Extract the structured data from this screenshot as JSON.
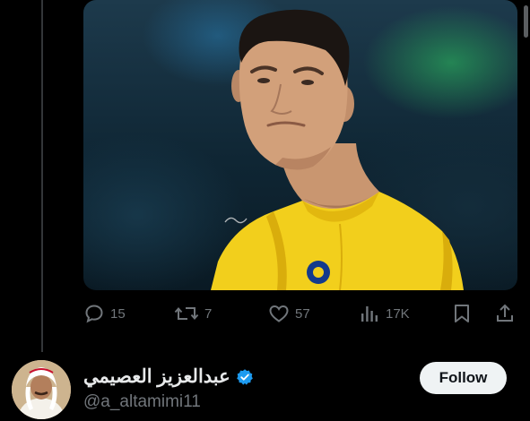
{
  "tweet": {
    "media": {
      "type": "photo",
      "watermark_icon": "signature-watermark-icon"
    },
    "actions": {
      "reply": {
        "icon": "reply-icon",
        "count": "15"
      },
      "retweet": {
        "icon": "retweet-icon",
        "count": "7"
      },
      "like": {
        "icon": "heart-icon",
        "count": "57"
      },
      "views": {
        "icon": "views-icon",
        "count": "17K"
      },
      "bookmark": {
        "icon": "bookmark-icon"
      },
      "share": {
        "icon": "share-icon"
      }
    }
  },
  "author_card": {
    "display_name": "عبدالعزيز العصيمي",
    "handle": "@a_altamimi11",
    "verified": true,
    "verified_icon": "verified-badge-icon",
    "follow_label": "Follow"
  },
  "colors": {
    "background": "#000000",
    "secondary_text": "#71767b",
    "primary_text": "#e7e9ea",
    "verified_blue": "#1d9bf0",
    "follow_button_bg": "#eff3f4",
    "follow_button_text": "#0f1419",
    "jersey_yellow": "#f2cf1c"
  }
}
